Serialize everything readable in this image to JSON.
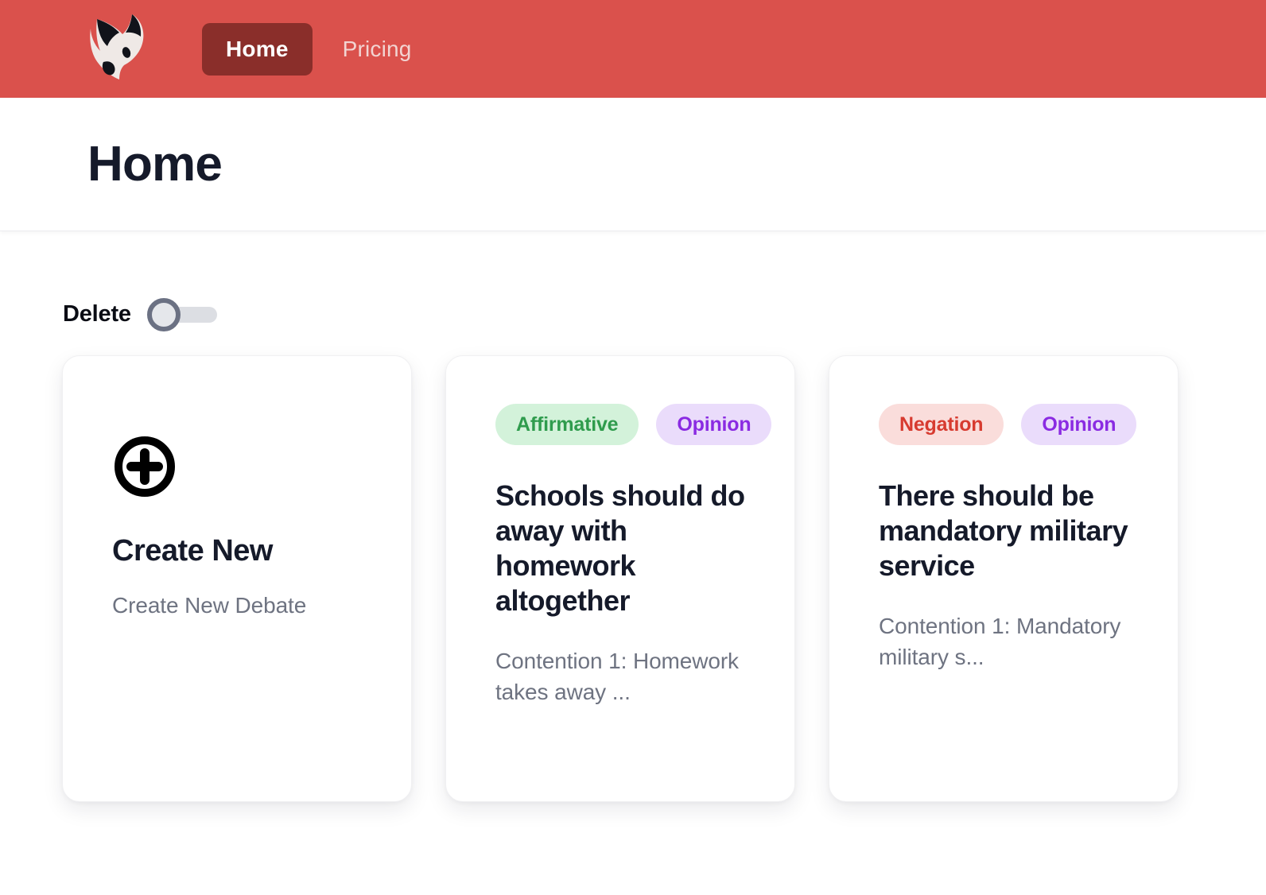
{
  "navbar": {
    "logo_name": "wolf-head-logo",
    "background_color": "#da514c",
    "active_background_color": "#8a2e2a",
    "links": [
      {
        "label": "Home",
        "active": true
      },
      {
        "label": "Pricing",
        "active": false
      }
    ]
  },
  "header": {
    "title": "Home"
  },
  "controls": {
    "delete_toggle": {
      "label": "Delete",
      "state": "off"
    }
  },
  "cards": {
    "create": {
      "icon": "plus-circle-icon",
      "heading": "Create New",
      "subtitle": "Create New Debate"
    },
    "debates": [
      {
        "badges": [
          {
            "label": "Affirmative",
            "kind": "affirmative",
            "text_color": "#2f9c4d",
            "bg_color": "#d3f2da"
          },
          {
            "label": "Opinion",
            "kind": "opinion",
            "text_color": "#8a2be2",
            "bg_color": "#eadcfb"
          }
        ],
        "heading": "Schools should do away with homework altogether",
        "snippet": "Contention 1: Homework takes away ..."
      },
      {
        "badges": [
          {
            "label": "Negation",
            "kind": "negation",
            "text_color": "#d73b30",
            "bg_color": "#fadddb"
          },
          {
            "label": "Opinion",
            "kind": "opinion",
            "text_color": "#8a2be2",
            "bg_color": "#eadcfb"
          }
        ],
        "heading": "There should be mandatory military service",
        "snippet": "Contention 1: Mandatory military s..."
      }
    ]
  }
}
